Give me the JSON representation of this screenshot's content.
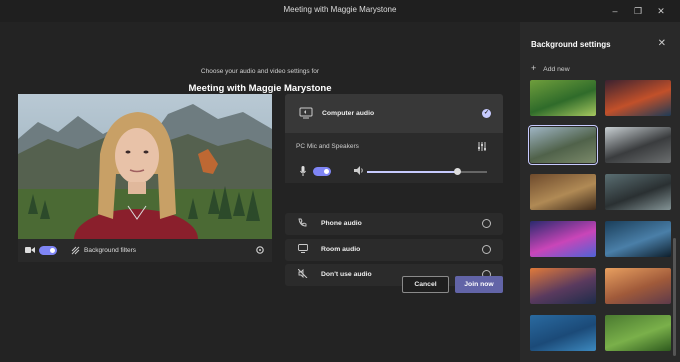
{
  "window": {
    "title": "Meeting with Maggie Marystone",
    "minimize_glyph": "–",
    "maximize_glyph": "❐",
    "close_glyph": "✕"
  },
  "prejoin": {
    "subtitle": "Choose your audio and video settings for",
    "meeting_name": "Meeting with Maggie Marystone"
  },
  "video_bar": {
    "camera_on": true,
    "background_filters_label": "Background filters"
  },
  "audio": {
    "computer_audio_label": "Computer audio",
    "computer_audio_selected": true,
    "device_label": "PC Mic and Speakers",
    "mic_on": true,
    "speaker_volume": 0.75,
    "options": [
      {
        "label": "Phone audio",
        "icon": "phone-icon"
      },
      {
        "label": "Room audio",
        "icon": "monitor-icon"
      },
      {
        "label": "Don't use audio",
        "icon": "no-audio-icon"
      }
    ]
  },
  "buttons": {
    "cancel": "Cancel",
    "join": "Join now"
  },
  "background_panel": {
    "title": "Background settings",
    "add_new": "Add new",
    "selected_index": 2,
    "thumbnails": [
      {
        "name": "game-village",
        "colors": [
          "#6f9e3c",
          "#2f6b2a",
          "#a7c860"
        ]
      },
      {
        "name": "game-ruins",
        "colors": [
          "#3b2230",
          "#c2502a",
          "#1d3b56"
        ]
      },
      {
        "name": "mountain-valley",
        "colors": [
          "#9fb5c4",
          "#50624a",
          "#7b8a6a"
        ]
      },
      {
        "name": "stone-arch",
        "colors": [
          "#c9d0d3",
          "#3a3c3e",
          "#6b6e6f"
        ]
      },
      {
        "name": "desert-street",
        "colors": [
          "#6e4a2c",
          "#b08a55",
          "#3e2a1a"
        ]
      },
      {
        "name": "dark-fortress",
        "colors": [
          "#5a6e72",
          "#2a3032",
          "#849496"
        ]
      },
      {
        "name": "pink-nebula",
        "colors": [
          "#2a2a6e",
          "#c945b8",
          "#4f63d6"
        ]
      },
      {
        "name": "blue-forest",
        "colors": [
          "#1a3e5a",
          "#4a7fa8",
          "#0e1f2c"
        ]
      },
      {
        "name": "sunset-town",
        "colors": [
          "#e07a3a",
          "#5a3a5e",
          "#1e2c4a"
        ]
      },
      {
        "name": "canyon-sunset",
        "colors": [
          "#e8a060",
          "#a05a3a",
          "#5e3a4a"
        ]
      },
      {
        "name": "blue-gradient",
        "colors": [
          "#2a6aa0",
          "#1b4a78",
          "#3d8ac0"
        ]
      },
      {
        "name": "green-field",
        "colors": [
          "#4a7a30",
          "#7ab04a",
          "#2e5a1e"
        ]
      }
    ]
  }
}
